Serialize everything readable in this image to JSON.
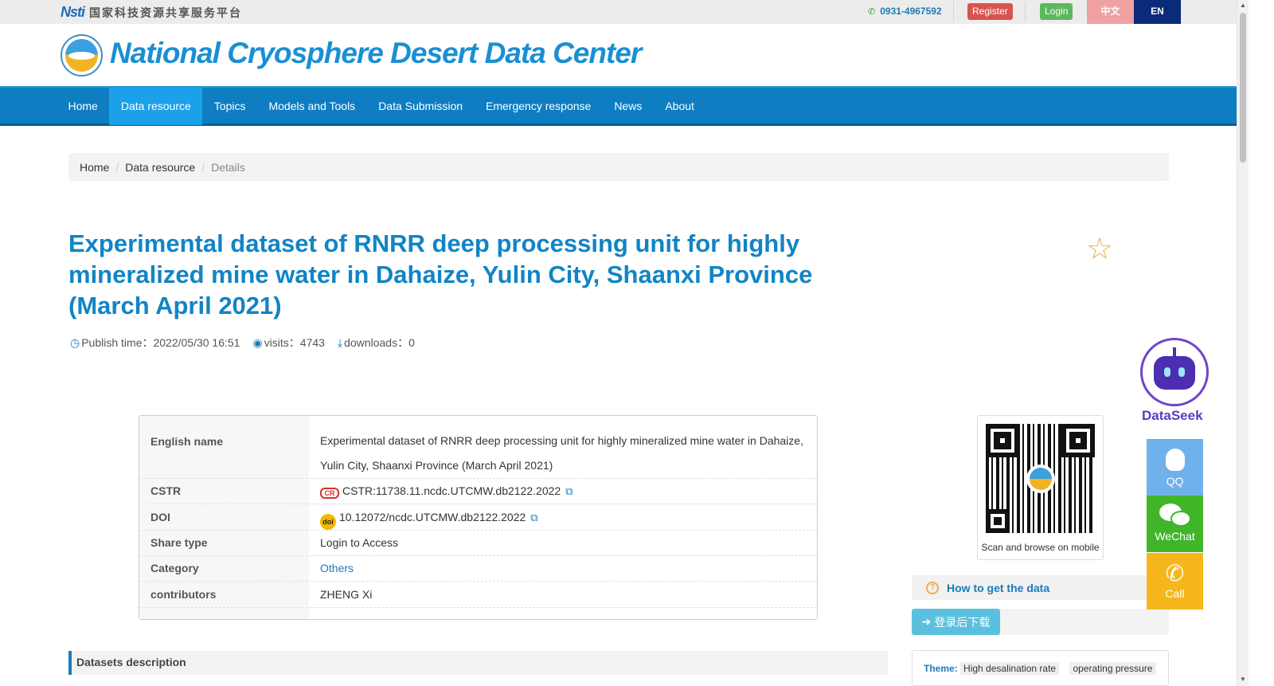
{
  "topbar": {
    "portal_mark": "Nsti",
    "portal_name": "国家科技资源共享服务平台",
    "phone": "0931-4967592",
    "register": "Register",
    "login": "Login",
    "lang_zh": "中文",
    "lang_en": "EN"
  },
  "header": {
    "site_title": "National Cryosphere Desert Data Center"
  },
  "nav": {
    "items": [
      "Home",
      "Data resource",
      "Topics",
      "Models and Tools",
      "Data Submission",
      "Emergency response",
      "News",
      "About"
    ],
    "active_index": 1
  },
  "breadcrumb": {
    "home": "Home",
    "section": "Data resource",
    "current": "Details"
  },
  "dataset": {
    "title": "Experimental dataset of RNRR deep processing unit for highly mineralized mine water in Dahaize, Yulin City, Shaanxi Province (March April 2021)",
    "publish_time": "Publish time：2022/05/30 16:51",
    "visits": "visits：4743",
    "downloads": "downloads：0"
  },
  "info": {
    "english_name_label": "English name",
    "english_name_line1": "Experimental dataset of RNRR deep processing unit for highly mineralized mine water in Dahaize,",
    "english_name_line2": "Yulin City, Shaanxi Province (March April 2021)",
    "cstr_label": "CSTR",
    "cstr_badge": "CR",
    "cstr_value": "CSTR:11738.11.ncdc.UTCMW.db2122.2022",
    "doi_label": "DOI",
    "doi_badge": "doi",
    "doi_value": "10.12072/ncdc.UTCMW.db2122.2022",
    "share_type_label": "Share type",
    "share_type_value": "Login to Access",
    "category_label": "Category",
    "category_value": "Others",
    "contributors_label": "contributors",
    "contributors_value": "ZHENG Xi"
  },
  "description": {
    "heading": "Datasets description"
  },
  "sidebar": {
    "qr_caption": "Scan and browse on mobile",
    "how_to": "How to get the data",
    "download_button": "登录后下载",
    "theme_label": "Theme:",
    "theme_tags": [
      "High desalination rate",
      "operating pressure"
    ]
  },
  "floating": {
    "dataseek": "DataSeek",
    "qq": "QQ",
    "wechat": "WeChat",
    "call": "Call"
  },
  "colors": {
    "nav_bg": "#0e7dc2",
    "nav_active": "#1ba0ea",
    "title": "#1184c5",
    "register": "#d9534f",
    "login": "#5cb85c",
    "lang_en_bg": "#0a2a7a",
    "star": "#f0ad4e"
  },
  "icons": [
    "phone-icon",
    "star-icon",
    "clock-icon",
    "eye-icon",
    "download-icon",
    "external-link-icon",
    "question-icon",
    "sign-in-icon",
    "robot-icon",
    "qq-icon",
    "wechat-icon",
    "phone-call-icon"
  ]
}
